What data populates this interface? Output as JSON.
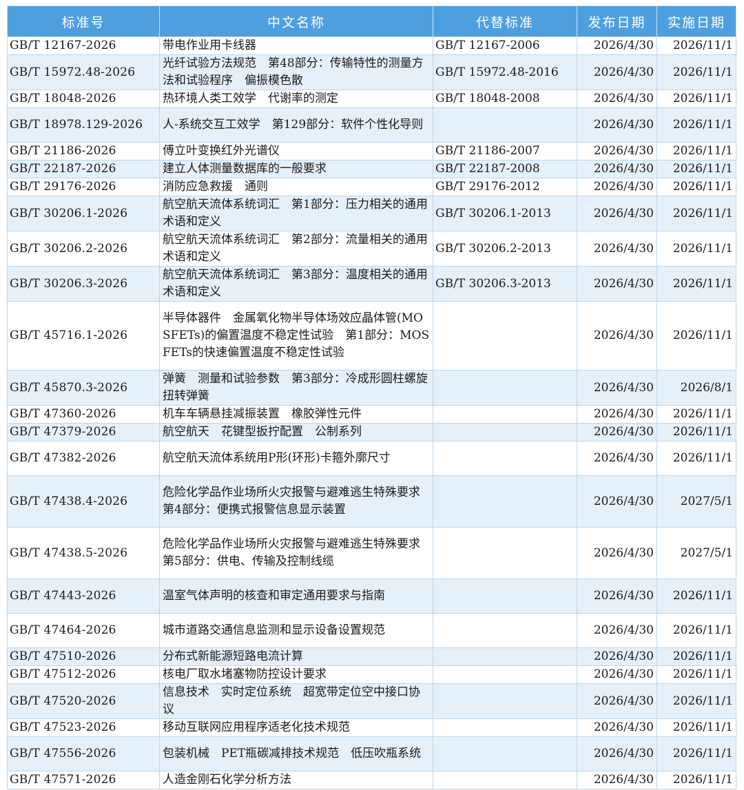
{
  "headers": [
    "标准号",
    "中文名称",
    "代替标准",
    "发布日期",
    "实施日期"
  ],
  "rows": [
    {
      "code": "GB/T 12167-2026",
      "name": "带电作业用卡线器",
      "replaces": "GB/T 12167-2006",
      "published": "2026/4/30",
      "effective": "2026/11/1"
    },
    {
      "code": "GB/T 15972.48-2026",
      "name": "光纤试验方法规范　第48部分：传输特性的测量方法和试验程序　偏振模色散",
      "replaces": "GB/T 15972.48-2016",
      "published": "2026/4/30",
      "effective": "2026/11/1"
    },
    {
      "code": "GB/T 18048-2026",
      "name": "热环境人类工效学　代谢率的测定",
      "replaces": "GB/T 18048-2008",
      "published": "2026/4/30",
      "effective": "2026/11/1"
    },
    {
      "code": "GB/T 18978.129-2026",
      "name": "人-系统交互工效学　第129部分：软件个性化导则",
      "replaces": "",
      "published": "2026/4/30",
      "effective": "2026/11/1"
    },
    {
      "code": "GB/T 21186-2026",
      "name": "傅立叶变换红外光谱仪",
      "replaces": "GB/T 21186-2007",
      "published": "2026/4/30",
      "effective": "2026/11/1"
    },
    {
      "code": "GB/T 22187-2026",
      "name": "建立人体测量数据库的一般要求",
      "replaces": "GB/T 22187-2008",
      "published": "2026/4/30",
      "effective": "2026/11/1"
    },
    {
      "code": "GB/T 29176-2026",
      "name": "消防应急救援　通则",
      "replaces": "GB/T 29176-2012",
      "published": "2026/4/30",
      "effective": "2026/11/1"
    },
    {
      "code": "GB/T 30206.1-2026",
      "name": "航空航天流体系统词汇　第1部分：压力相关的通用术语和定义",
      "replaces": "GB/T 30206.1-2013",
      "published": "2026/4/30",
      "effective": "2026/11/1"
    },
    {
      "code": "GB/T 30206.2-2026",
      "name": "航空航天流体系统词汇　第2部分：流量相关的通用术语和定义",
      "replaces": "GB/T 30206.2-2013",
      "published": "2026/4/30",
      "effective": "2026/11/1"
    },
    {
      "code": "GB/T 30206.3-2026",
      "name": "航空航天流体系统词汇　第3部分：温度相关的通用术语和定义",
      "replaces": "GB/T 30206.3-2013",
      "published": "2026/4/30",
      "effective": "2026/11/1"
    },
    {
      "code": "GB/T 45716.1-2026",
      "name": "半导体器件　金属氧化物半导体场效应晶体管(MOSFETs)的偏置温度不稳定性试验　第1部分：MOSFETs的快速偏置温度不稳定性试验",
      "replaces": "",
      "published": "2026/4/30",
      "effective": "2026/11/1"
    },
    {
      "code": "GB/T 45870.3-2026",
      "name": "弹簧　测量和试验参数　第3部分：冷成形圆柱螺旋扭转弹簧",
      "replaces": "",
      "published": "2026/4/30",
      "effective": "2026/8/1"
    },
    {
      "code": "GB/T 47360-2026",
      "name": "机车车辆悬挂减振装置　橡胶弹性元件",
      "replaces": "",
      "published": "2026/4/30",
      "effective": "2026/11/1"
    },
    {
      "code": "GB/T 47379-2026",
      "name": "航空航天　花键型扳拧配置　公制系列",
      "replaces": "",
      "published": "2026/4/30",
      "effective": "2026/11/1"
    },
    {
      "code": "GB/T 47382-2026",
      "name": "航空航天流体系统用P形(环形)卡箍外廓尺寸",
      "replaces": "",
      "published": "2026/4/30",
      "effective": "2026/11/1"
    },
    {
      "code": "GB/T 47438.4-2026",
      "name": "危险化学品作业场所火灾报警与避难逃生特殊要求　第4部分：便携式报警信息显示装置",
      "replaces": "",
      "published": "2026/4/30",
      "effective": "2027/5/1"
    },
    {
      "code": "GB/T 47438.5-2026",
      "name": "危险化学品作业场所火灾报警与避难逃生特殊要求　第5部分：供电、传输及控制线缆",
      "replaces": "",
      "published": "2026/4/30",
      "effective": "2027/5/1"
    },
    {
      "code": "GB/T 47443-2026",
      "name": "温室气体声明的核查和审定通用要求与指南",
      "replaces": "",
      "published": "2026/4/30",
      "effective": "2026/11/1"
    },
    {
      "code": "GB/T 47464-2026",
      "name": "城市道路交通信息监测和显示设备设置规范",
      "replaces": "",
      "published": "2026/4/30",
      "effective": "2026/11/1"
    },
    {
      "code": "GB/T 47510-2026",
      "name": "分布式新能源短路电流计算",
      "replaces": "",
      "published": "2026/4/30",
      "effective": "2026/11/1"
    },
    {
      "code": "GB/T 47512-2026",
      "name": "核电厂取水堵塞物防控设计要求",
      "replaces": "",
      "published": "2026/4/30",
      "effective": "2026/11/1"
    },
    {
      "code": "GB/T 47520-2026",
      "name": "信息技术　实时定位系统　超宽带定位空中接口协议",
      "replaces": "",
      "published": "2026/4/30",
      "effective": "2026/11/1"
    },
    {
      "code": "GB/T 47523-2026",
      "name": "移动互联网应用程序适老化技术规范",
      "replaces": "",
      "published": "2026/4/30",
      "effective": "2026/11/1"
    },
    {
      "code": "GB/T 47556-2026",
      "name": "包装机械　PET瓶碳减排技术规范　低压吹瓶系统",
      "replaces": "",
      "published": "2026/4/30",
      "effective": "2026/11/1"
    },
    {
      "code": "GB/T 47571-2026",
      "name": "人造金刚石化学分析方法",
      "replaces": "",
      "published": "2026/4/30",
      "effective": "2026/11/1"
    }
  ]
}
